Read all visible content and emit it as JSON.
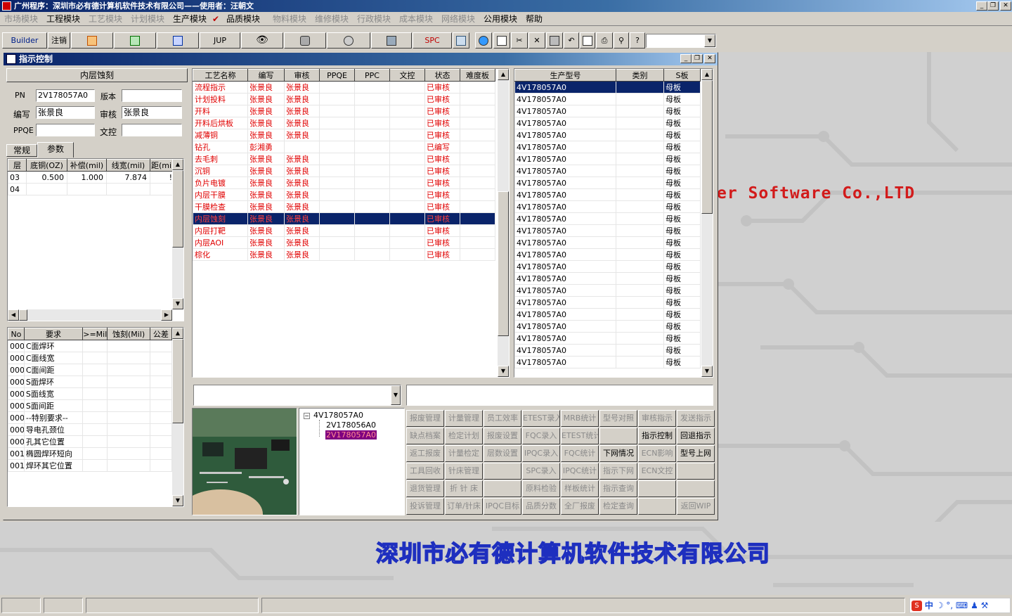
{
  "app": {
    "title": "广州程序：深圳市必有德计算机软件技术有限公司——使用者：汪朝文",
    "minimize": "_",
    "restore": "❐",
    "close": "✕"
  },
  "menu": [
    {
      "label": "市场模块",
      "enabled": false
    },
    {
      "label": "工程模块",
      "enabled": true
    },
    {
      "label": "工艺模块",
      "enabled": false
    },
    {
      "label": "计划模块",
      "enabled": false
    },
    {
      "label": "生产模块",
      "enabled": true
    },
    {
      "label": "品质模块",
      "enabled": true
    },
    {
      "label": "物料模块",
      "enabled": false
    },
    {
      "label": "维修模块",
      "enabled": false
    },
    {
      "label": "行政模块",
      "enabled": false
    },
    {
      "label": "成本模块",
      "enabled": false
    },
    {
      "label": "网络模块",
      "enabled": false
    },
    {
      "label": "公用模块",
      "enabled": true
    },
    {
      "label": "帮助",
      "enabled": true
    }
  ],
  "toolbar": {
    "builder": "Builder",
    "logout": "注销",
    "jup": "JUP",
    "spc": "SPC",
    "combo_value": ""
  },
  "watermark": {
    "en": "er Software Co.,LTD",
    "cn": "深圳市必有德计算机软件技术有限公司"
  },
  "window": {
    "title": "指示控制",
    "controls": [
      "_",
      "❐",
      "✕"
    ]
  },
  "left": {
    "process": "内层蚀刻",
    "pn_label": "PN",
    "pn": "2V178057A0",
    "version_label": "版本",
    "version": "",
    "writer_label": "编写",
    "writer": "张景良",
    "reviewer_label": "审核",
    "reviewer": "张景良",
    "ppqe_label": "PPQE",
    "ppqe": "",
    "dc_label": "文控",
    "dc": "",
    "tabs": [
      "常规",
      "参数"
    ],
    "layer_headers": [
      "层",
      "底铜(OZ)",
      "补偿(mil)",
      "线宽(mil)",
      "距(mi"
    ],
    "layer_rows": [
      [
        "03",
        "0.500",
        "1.000",
        "7.874",
        "!"
      ],
      [
        "04",
        "",
        "",
        "",
        ""
      ]
    ],
    "req_headers": [
      "No",
      "要求",
      ">=Mil",
      "蚀刻(Mil)",
      "公差"
    ],
    "req_rows": [
      [
        "000",
        "C面焊环"
      ],
      [
        "000",
        "C面线宽"
      ],
      [
        "000",
        "C面间距"
      ],
      [
        "000",
        "S面焊环"
      ],
      [
        "000",
        "S面线宽"
      ],
      [
        "000",
        "S面间距"
      ],
      [
        "000",
        "--特别要求--"
      ],
      [
        "000",
        "导电孔颈位"
      ],
      [
        "000",
        "孔其它位置"
      ],
      [
        "001",
        "椭圆焊环短向"
      ],
      [
        "001",
        "焊环其它位置"
      ]
    ]
  },
  "process_grid": {
    "headers": [
      "工艺名称",
      "编写",
      "审核",
      "PPQE",
      "PPC",
      "文控",
      "状态",
      "难度板"
    ],
    "rows": [
      [
        "流程指示",
        "张景良",
        "张景良",
        "",
        "",
        "",
        "已审核",
        ""
      ],
      [
        "计划投料",
        "张景良",
        "张景良",
        "",
        "",
        "",
        "已审核",
        ""
      ],
      [
        "开料",
        "张景良",
        "张景良",
        "",
        "",
        "",
        "已审核",
        ""
      ],
      [
        "开料后烘板",
        "张景良",
        "张景良",
        "",
        "",
        "",
        "已审核",
        ""
      ],
      [
        "减薄铜",
        "张景良",
        "张景良",
        "",
        "",
        "",
        "已审核",
        ""
      ],
      [
        "钻孔",
        "彭湘勇",
        "",
        "",
        "",
        "",
        "已编写",
        ""
      ],
      [
        "去毛刺",
        "张景良",
        "张景良",
        "",
        "",
        "",
        "已审核",
        ""
      ],
      [
        "沉铜",
        "张景良",
        "张景良",
        "",
        "",
        "",
        "已审核",
        ""
      ],
      [
        "负片电镀",
        "张景良",
        "张景良",
        "",
        "",
        "",
        "已审核",
        ""
      ],
      [
        "内层干膜",
        "张景良",
        "张景良",
        "",
        "",
        "",
        "已审核",
        ""
      ],
      [
        "干膜检查",
        "张景良",
        "张景良",
        "",
        "",
        "",
        "已审核",
        ""
      ],
      [
        "内层蚀刻",
        "张景良",
        "张景良",
        "",
        "",
        "",
        "已审核",
        ""
      ],
      [
        "内层打靶",
        "张景良",
        "张景良",
        "",
        "",
        "",
        "已审核",
        ""
      ],
      [
        "内层AOI",
        "张景良",
        "张景良",
        "",
        "",
        "",
        "已审核",
        ""
      ],
      [
        "棕化",
        "张景良",
        "张景良",
        "",
        "",
        "",
        "已审核",
        ""
      ]
    ],
    "selected_index": 11
  },
  "model_grid": {
    "headers": [
      "生产型号",
      "类别",
      "S板"
    ],
    "rows": [
      [
        "4V178057A0",
        "",
        "母板"
      ],
      [
        "4V178057A0",
        "",
        "母板"
      ],
      [
        "4V178057A0",
        "",
        "母板"
      ],
      [
        "4V178057A0",
        "",
        "母板"
      ],
      [
        "4V178057A0",
        "",
        "母板"
      ],
      [
        "4V178057A0",
        "",
        "母板"
      ],
      [
        "4V178057A0",
        "",
        "母板"
      ],
      [
        "4V178057A0",
        "",
        "母板"
      ],
      [
        "4V178057A0",
        "",
        "母板"
      ],
      [
        "4V178057A0",
        "",
        "母板"
      ],
      [
        "4V178057A0",
        "",
        "母板"
      ],
      [
        "4V178057A0",
        "",
        "母板"
      ],
      [
        "4V178057A0",
        "",
        "母板"
      ],
      [
        "4V178057A0",
        "",
        "母板"
      ],
      [
        "4V178057A0",
        "",
        "母板"
      ],
      [
        "4V178057A0",
        "",
        "母板"
      ],
      [
        "4V178057A0",
        "",
        "母板"
      ],
      [
        "4V178057A0",
        "",
        "母板"
      ],
      [
        "4V178057A0",
        "",
        "母板"
      ],
      [
        "4V178057A0",
        "",
        "母板"
      ],
      [
        "4V178057A0",
        "",
        "母板"
      ],
      [
        "4V178057A0",
        "",
        "母板"
      ],
      [
        "4V178057A0",
        "",
        "母板"
      ],
      [
        "4V178057A0",
        "",
        "母板"
      ]
    ],
    "selected_index": 0
  },
  "tree": {
    "root": "4V178057A0",
    "children": [
      "2V178056A0",
      "2V178057A0"
    ],
    "selected_child": 1
  },
  "buttons": [
    [
      "报废管理",
      "计量管理",
      "员工效率",
      "ETEST录入",
      "MRB统计",
      "型号对照",
      "审核指示",
      "发送指示"
    ],
    [
      "缺点档案",
      "检定计划",
      "报废设置",
      "FQC录入",
      "ETEST统计",
      "",
      "指示控制",
      "回退指示"
    ],
    [
      "返工报废",
      "计量检定",
      "层数设置",
      "IPQC录入",
      "FQC统计",
      "下网情况",
      "ECN影响",
      "型号上网"
    ],
    [
      "工具回收",
      "针床管理",
      "",
      "SPC录入",
      "IPQC统计",
      "指示下网",
      "ECN文控",
      ""
    ],
    [
      "退货管理",
      "折 针 床",
      "",
      "原料检验",
      "样板统计",
      "指示查询",
      "",
      ""
    ],
    [
      "投诉管理",
      "订单/针床",
      "IPQC目标",
      "品质分数",
      "全厂报废",
      "检定查询",
      "",
      "返回WIP"
    ]
  ],
  "enabled_buttons": [
    "下网情况",
    "指示控制",
    "回退指示",
    "型号上网"
  ],
  "tray": {
    "ime": "中"
  }
}
